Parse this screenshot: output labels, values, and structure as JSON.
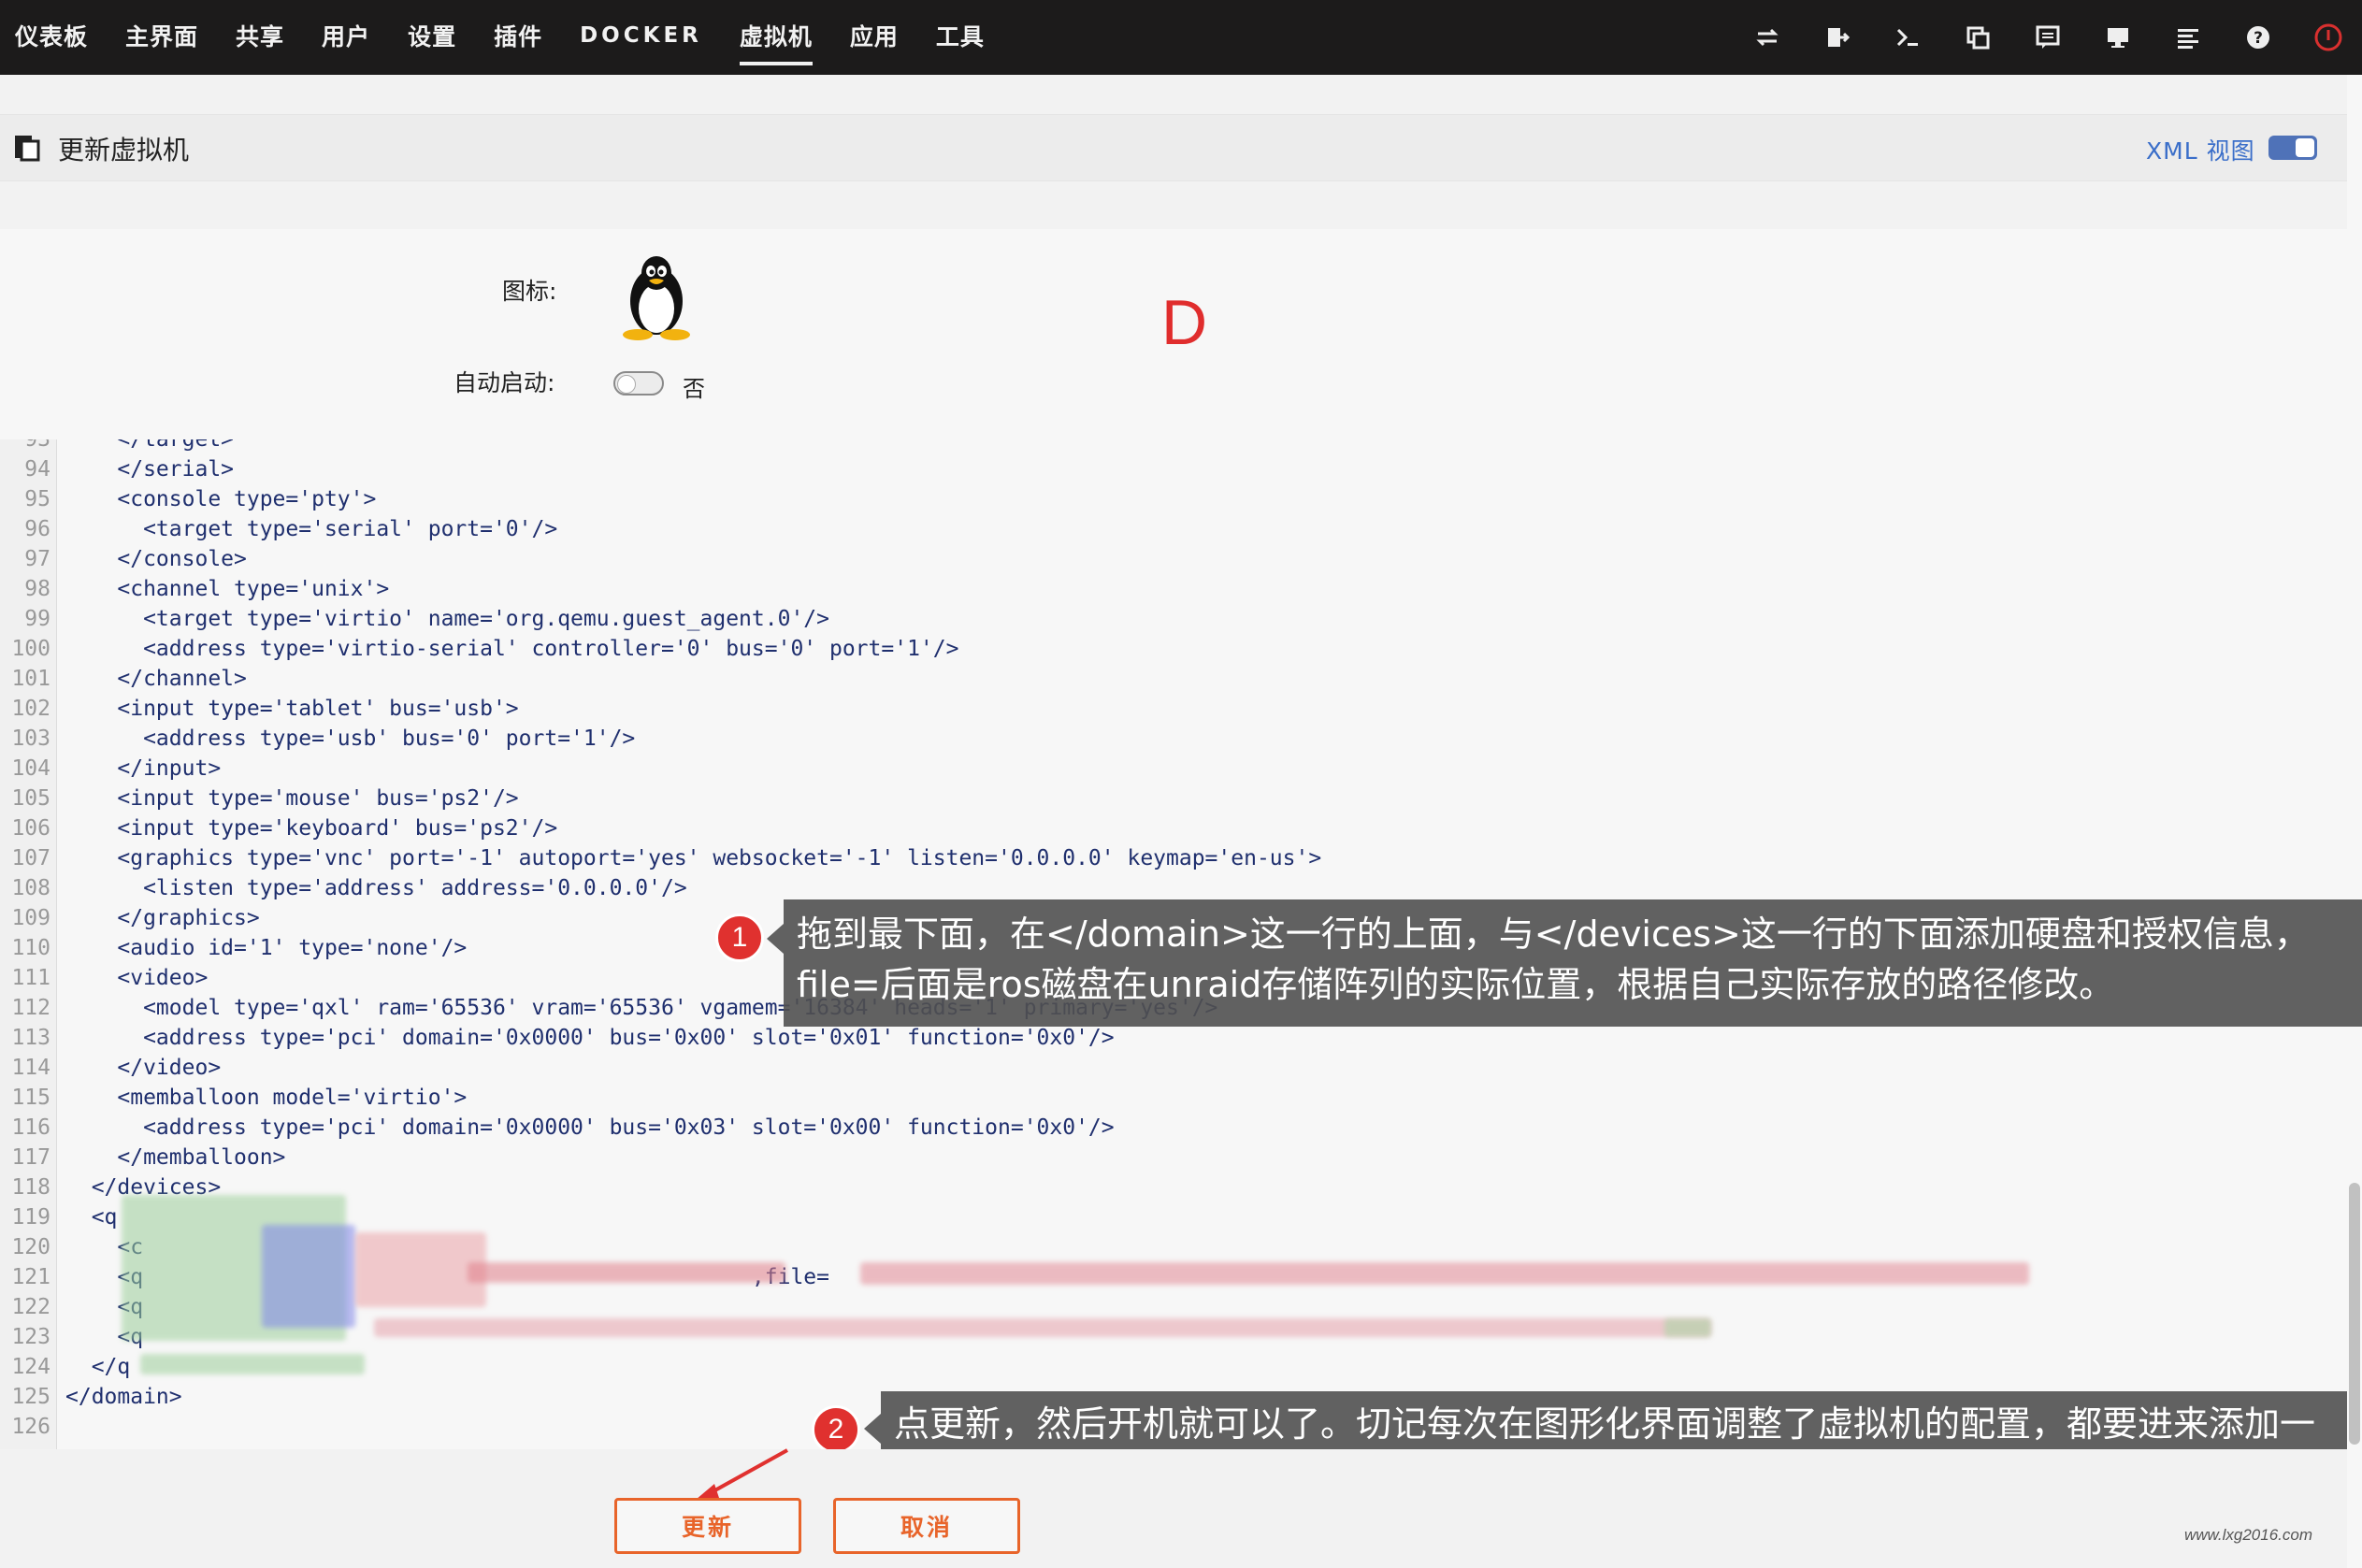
{
  "nav": {
    "items": [
      {
        "label": "仪表板",
        "latin": false,
        "active": false
      },
      {
        "label": "主界面",
        "latin": false,
        "active": false
      },
      {
        "label": "共享",
        "latin": false,
        "active": false
      },
      {
        "label": "用户",
        "latin": false,
        "active": false
      },
      {
        "label": "设置",
        "latin": false,
        "active": false
      },
      {
        "label": "插件",
        "latin": false,
        "active": false
      },
      {
        "label": "DOCKER",
        "latin": true,
        "active": false
      },
      {
        "label": "虚拟机",
        "latin": false,
        "active": true
      },
      {
        "label": "应用",
        "latin": false,
        "active": false
      },
      {
        "label": "工具",
        "latin": false,
        "active": false
      }
    ],
    "icons": [
      "switch-icon",
      "logout-icon",
      "terminal-icon",
      "copy-icon",
      "feedback-icon",
      "monitor-icon",
      "log-icon",
      "help-icon",
      "power-icon"
    ]
  },
  "page": {
    "title": "更新虚拟机",
    "xml_view_label": "XML 视图",
    "xml_view_on": true
  },
  "form": {
    "icon_label": "图标:",
    "autostart_label": "自动启动:",
    "autostart_value": "否",
    "overlay_letter": "D"
  },
  "code": {
    "lines": [
      {
        "n": "93",
        "t": "    </target>"
      },
      {
        "n": "94",
        "t": "    </serial>"
      },
      {
        "n": "95",
        "t": "    <console type='pty'>"
      },
      {
        "n": "96",
        "t": "      <target type='serial' port='0'/>"
      },
      {
        "n": "97",
        "t": "    </console>"
      },
      {
        "n": "98",
        "t": "    <channel type='unix'>"
      },
      {
        "n": "99",
        "t": "      <target type='virtio' name='org.qemu.guest_agent.0'/>"
      },
      {
        "n": "100",
        "t": "      <address type='virtio-serial' controller='0' bus='0' port='1'/>"
      },
      {
        "n": "101",
        "t": "    </channel>"
      },
      {
        "n": "102",
        "t": "    <input type='tablet' bus='usb'>"
      },
      {
        "n": "103",
        "t": "      <address type='usb' bus='0' port='1'/>"
      },
      {
        "n": "104",
        "t": "    </input>"
      },
      {
        "n": "105",
        "t": "    <input type='mouse' bus='ps2'/>"
      },
      {
        "n": "106",
        "t": "    <input type='keyboard' bus='ps2'/>"
      },
      {
        "n": "107",
        "t": "    <graphics type='vnc' port='-1' autoport='yes' websocket='-1' listen='0.0.0.0' keymap='en-us'>"
      },
      {
        "n": "108",
        "t": "      <listen type='address' address='0.0.0.0'/>"
      },
      {
        "n": "109",
        "t": "    </graphics>"
      },
      {
        "n": "110",
        "t": "    <audio id='1' type='none'/>"
      },
      {
        "n": "111",
        "t": "    <video>"
      },
      {
        "n": "112",
        "t": "      <model type='qxl' ram='65536' vram='65536' vgamem='16384' heads='1' primary='yes'/>"
      },
      {
        "n": "113",
        "t": "      <address type='pci' domain='0x0000' bus='0x00' slot='0x01' function='0x0'/>"
      },
      {
        "n": "114",
        "t": "    </video>"
      },
      {
        "n": "115",
        "t": "    <memballoon model='virtio'>"
      },
      {
        "n": "116",
        "t": "      <address type='pci' domain='0x0000' bus='0x03' slot='0x00' function='0x0'/>"
      },
      {
        "n": "117",
        "t": "    </memballoon>"
      },
      {
        "n": "118",
        "t": "  </devices>"
      },
      {
        "n": "119",
        "t": "  <q"
      },
      {
        "n": "120",
        "t": "    <c"
      },
      {
        "n": "121",
        "t": "    <q                                               ,file="
      },
      {
        "n": "122",
        "t": "    <q"
      },
      {
        "n": "123",
        "t": "    <q"
      },
      {
        "n": "124",
        "t": "  </q"
      },
      {
        "n": "125",
        "t": "</domain>"
      },
      {
        "n": "126",
        "t": ""
      }
    ]
  },
  "annotations": {
    "step1_number": "1",
    "step1_text": "拖到最下面，在</domain>这一行的上面，与</devices>这一行的下面添加硬盘和授权信息，file=后面是ros磁盘在unraid存储阵列的实际位置，根据自己实际存放的路径修改。",
    "step2_number": "2",
    "step2_text": "点更新，然后开机就可以了。切记每次在图形化界面调整了虚拟机的配置，都要进来添加一次。"
  },
  "buttons": {
    "update_label": "更新",
    "cancel_label": "取消"
  },
  "watermark": "www.lxg2016.com",
  "colors": {
    "topbar": "#1c1b1b",
    "accent_orange": "#e8642a",
    "annotation_red": "#e0312f",
    "link_blue": "#3a6ec9"
  }
}
